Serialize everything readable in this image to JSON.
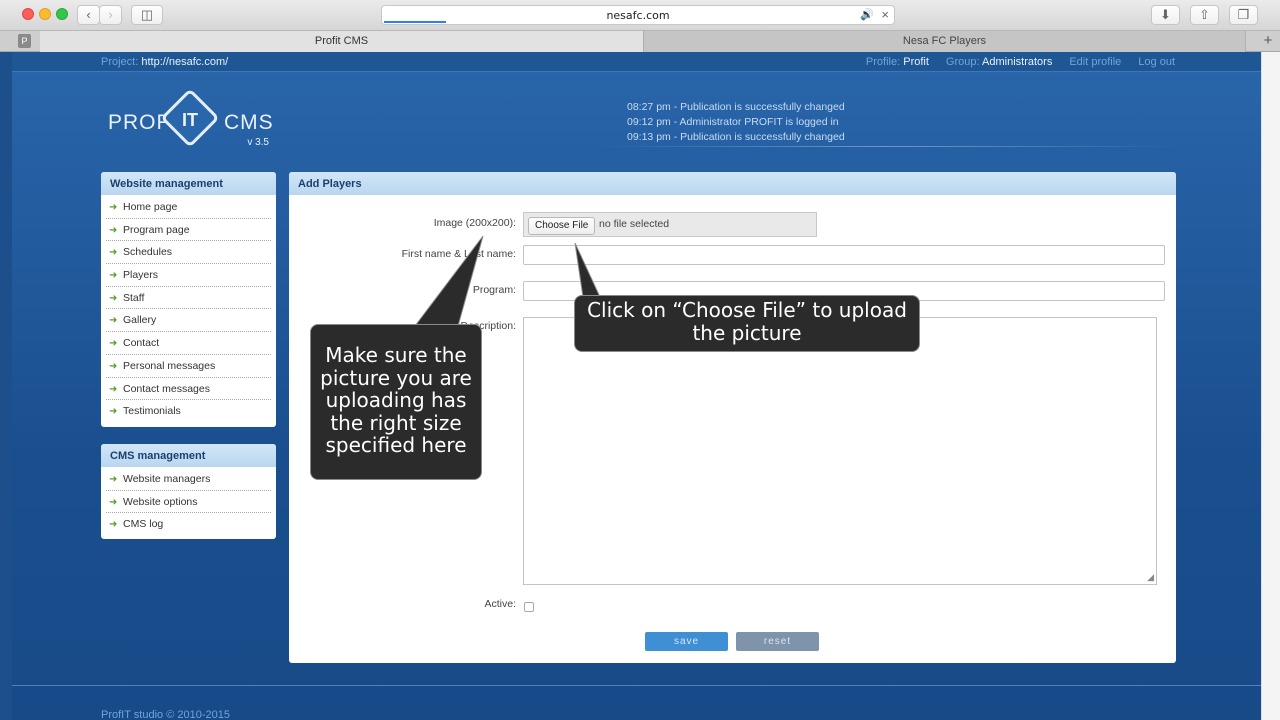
{
  "browser": {
    "url": "nesafc.com",
    "tabs": [
      {
        "label": "Profit CMS",
        "active": true
      },
      {
        "label": "Nesa FC Players",
        "active": false
      }
    ],
    "pinned_tab_letter": "P",
    "icons": [
      "back-icon",
      "forward-icon",
      "sidebar-icon",
      "audio-icon",
      "close-icon",
      "download-icon",
      "share-icon",
      "tabs-icon",
      "new-tab-icon"
    ]
  },
  "topbar": {
    "project_label": "Project:",
    "project_value": "http://nesafc.com/",
    "profile_label": "Profile:",
    "profile_value": "Profit",
    "group_label": "Group:",
    "group_value": "Administrators",
    "edit_profile": "Edit profile",
    "log_out": "Log out"
  },
  "logo": {
    "left": "PROF",
    "mid": "IT",
    "right": "CMS",
    "version": "v 3.5"
  },
  "activity_log": [
    "08:27 pm - Publication is successfully changed",
    "09:12 pm - Administrator PROFIT is logged in",
    "09:13 pm - Publication is successfully changed"
  ],
  "website_management": {
    "title": "Website management",
    "items": [
      "Home page",
      "Program page",
      "Schedules",
      "Players",
      "Staff",
      "Gallery",
      "Contact",
      "Personal messages",
      "Contact messages",
      "Testimonials"
    ]
  },
  "cms_management": {
    "title": "CMS management",
    "items": [
      "Website managers",
      "Website options",
      "CMS log"
    ]
  },
  "form": {
    "title": "Add Players",
    "image_label": "Image (200x200):",
    "choose_file": "Choose File",
    "no_file": "no file selected",
    "name_label": "First name & Last name:",
    "program_label": "Program:",
    "description_label": "Description:",
    "active_label": "Active:",
    "save": "save",
    "reset": "reset"
  },
  "callouts": {
    "size_hint": "Make sure the picture you are uploading has the right size specified here",
    "upload_hint": "Click on “Choose File” to upload the picture"
  },
  "footer": {
    "text": "ProfIT studio © 2010-2015"
  },
  "colors": {
    "page_bg": "#1d4f8c",
    "panel_head": "#c6def3",
    "save_button": "#3f8fd4",
    "reset_button": "#7f93ab",
    "nav_arrow": "#5a9a2b"
  }
}
